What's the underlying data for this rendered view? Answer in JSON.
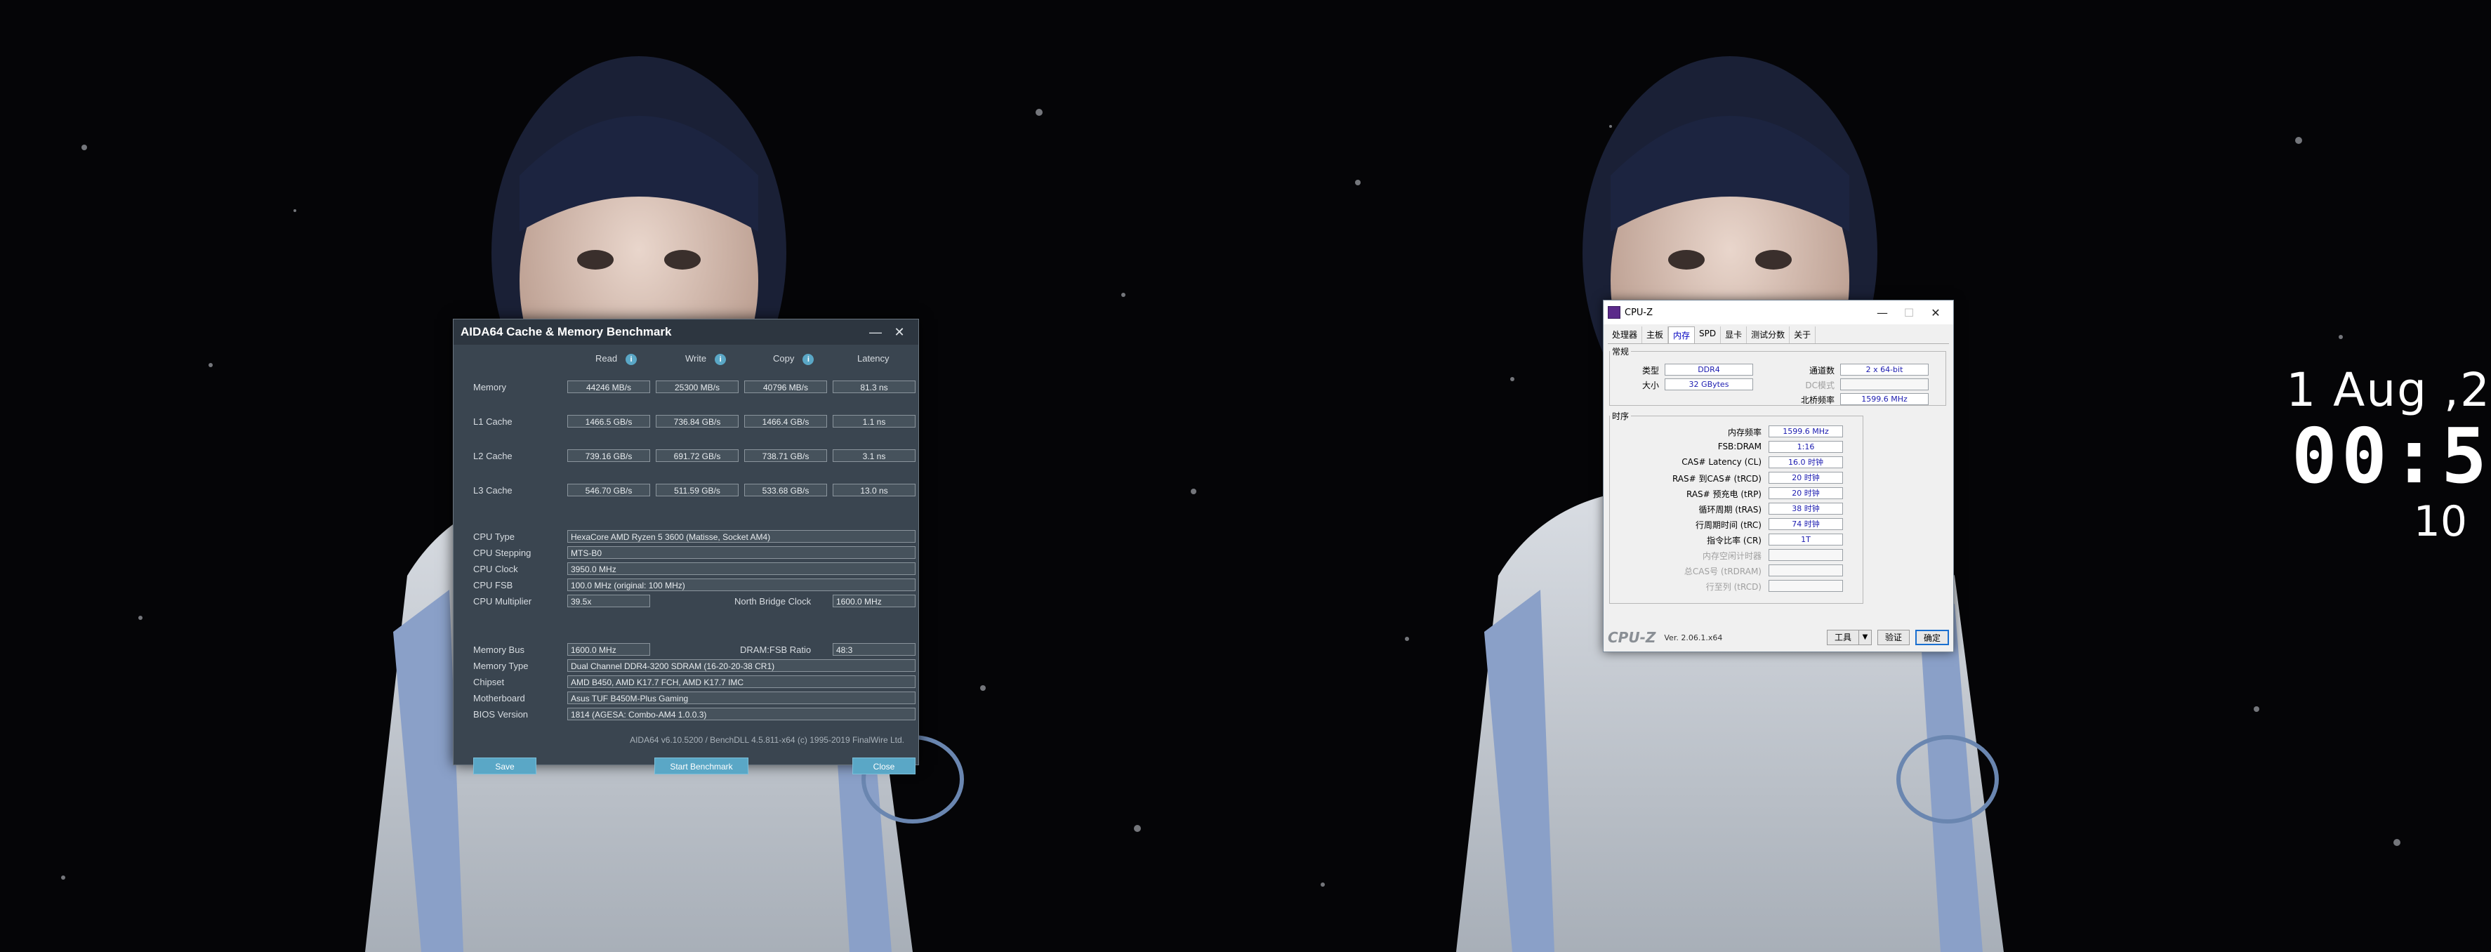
{
  "aida": {
    "title": "AIDA64 Cache & Memory Benchmark",
    "controls": {
      "minimize": "—",
      "close": "✕"
    },
    "columns": {
      "read": "Read",
      "write": "Write",
      "copy": "Copy",
      "latency": "Latency",
      "info": "i"
    },
    "bench": [
      {
        "label": "Memory",
        "read": "44246 MB/s",
        "write": "25300 MB/s",
        "copy": "40796 MB/s",
        "latency": "81.3 ns"
      },
      {
        "label": "L1 Cache",
        "read": "1466.5 GB/s",
        "write": "736.84 GB/s",
        "copy": "1466.4 GB/s",
        "latency": "1.1 ns"
      },
      {
        "label": "L2 Cache",
        "read": "739.16 GB/s",
        "write": "691.72 GB/s",
        "copy": "738.71 GB/s",
        "latency": "3.1 ns"
      },
      {
        "label": "L3 Cache",
        "read": "546.70 GB/s",
        "write": "511.59 GB/s",
        "copy": "533.68 GB/s",
        "latency": "13.0 ns"
      }
    ],
    "cpu": {
      "type_label": "CPU Type",
      "type": "HexaCore AMD Ryzen 5 3600  (Matisse, Socket AM4)",
      "stepping_label": "CPU Stepping",
      "stepping": "MTS-B0",
      "clock_label": "CPU Clock",
      "clock": "3950.0 MHz",
      "fsb_label": "CPU FSB",
      "fsb": "100.0 MHz  (original: 100 MHz)",
      "mult_label": "CPU Multiplier",
      "mult": "39.5x",
      "nb_label": "North Bridge Clock",
      "nb": "1600.0 MHz"
    },
    "mem": {
      "bus_label": "Memory Bus",
      "bus": "1600.0 MHz",
      "ratio_label": "DRAM:FSB Ratio",
      "ratio": "48:3",
      "type_label": "Memory Type",
      "type": "Dual Channel DDR4-3200 SDRAM  (16-20-20-38 CR1)",
      "chipset_label": "Chipset",
      "chipset": "AMD B450, AMD K17.7 FCH, AMD K17.7 IMC",
      "mobo_label": "Motherboard",
      "mobo": "Asus TUF B450M-Plus Gaming",
      "bios_label": "BIOS Version",
      "bios": "1814  (AGESA: Combo-AM4 1.0.0.3)"
    },
    "footer": "AIDA64 v6.10.5200 / BenchDLL 4.5.811-x64  (c) 1995-2019 FinalWire Ltd.",
    "buttons": {
      "save": "Save",
      "start": "Start Benchmark",
      "close": "Close"
    },
    "accent": "#5aa7c6"
  },
  "cpuz": {
    "title": "CPU-Z",
    "controls": {
      "minimize": "—",
      "maximize": "☐",
      "close": "✕"
    },
    "tabs": [
      "处理器",
      "主板",
      "内存",
      "SPD",
      "显卡",
      "测试分数",
      "关于"
    ],
    "general": {
      "legend": "常规",
      "type_label": "类型",
      "type": "DDR4",
      "size_label": "大小",
      "size": "32 GBytes",
      "channels_label": "通道数",
      "channels": "2 x 64-bit",
      "dc_label": "DC模式",
      "dc": "",
      "nb_label": "北桥频率",
      "nb": "1599.6 MHz"
    },
    "timings": {
      "legend": "时序",
      "rows": [
        {
          "label": "内存频率",
          "value": "1599.6 MHz",
          "dim": false
        },
        {
          "label": "FSB:DRAM",
          "value": "1:16",
          "dim": false
        },
        {
          "label": "CAS# Latency (CL)",
          "value": "16.0 时钟",
          "dim": false
        },
        {
          "label": "RAS# 到CAS# (tRCD)",
          "value": "20 时钟",
          "dim": false
        },
        {
          "label": "RAS# 预充电 (tRP)",
          "value": "20 时钟",
          "dim": false
        },
        {
          "label": "循环周期 (tRAS)",
          "value": "38 时钟",
          "dim": false
        },
        {
          "label": "行周期时间 (tRC)",
          "value": "74 时钟",
          "dim": false
        },
        {
          "label": "指令比率 (CR)",
          "value": "1T",
          "dim": false
        },
        {
          "label": "内存空闲计时器",
          "value": "",
          "dim": true
        },
        {
          "label": "总CAS号 (tRDRAM)",
          "value": "",
          "dim": true
        },
        {
          "label": "行至列 (tRCD)",
          "value": "",
          "dim": true
        }
      ]
    },
    "bottom": {
      "logo": "CPU-Z",
      "version": "Ver. 2.06.1.x64",
      "tools": "工具",
      "validate": "验证",
      "ok": "确定",
      "dropdown": "▼"
    }
  },
  "clock": {
    "date": "1 Aug ,2",
    "time": "00:5",
    "sub": "10"
  }
}
